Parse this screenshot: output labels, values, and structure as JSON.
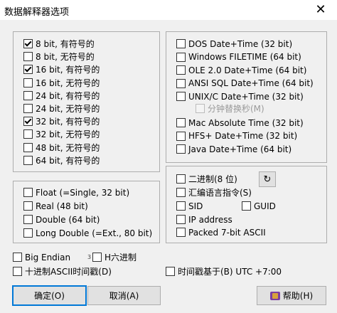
{
  "window": {
    "title": "数据解释器选项",
    "close_glyph": "✕"
  },
  "integer_panel": {
    "items": [
      {
        "label": "8 bit, 有符号的",
        "checked": true
      },
      {
        "label": "8 bit, 无符号的",
        "checked": false
      },
      {
        "label": "16 bit, 有符号的",
        "checked": true
      },
      {
        "label": "16 bit, 无符号的",
        "checked": false
      },
      {
        "label": "24 bit, 有符号的",
        "checked": false
      },
      {
        "label": "24 bit, 无符号的",
        "checked": false
      },
      {
        "label": "32 bit, 有符号的",
        "checked": true
      },
      {
        "label": "32 bit, 无符号的",
        "checked": false
      },
      {
        "label": "48 bit, 无符号的",
        "checked": false
      },
      {
        "label": "64 bit, 有符号的",
        "checked": false
      }
    ]
  },
  "float_panel": {
    "items": [
      {
        "label": "Float (=Single, 32 bit)",
        "checked": false
      },
      {
        "label": "Real (48 bit)",
        "checked": false
      },
      {
        "label": "Double (64 bit)",
        "checked": false
      },
      {
        "label": "Long Double (=Ext., 80 bit)",
        "checked": false
      }
    ]
  },
  "date_panel": {
    "items": [
      {
        "label": "DOS Date+Time (32 bit)",
        "checked": false
      },
      {
        "label": "Windows FILETIME (64 bit)",
        "checked": false
      },
      {
        "label": "OLE 2.0 Date+Time (64 bit)",
        "checked": false
      },
      {
        "label": "ANSI SQL Date+Time (64 bit)",
        "checked": false
      },
      {
        "label": "UNIX/C Date+Time (32 bit)",
        "checked": false
      }
    ],
    "minute_swap": {
      "label": "分钟替换秒(M)",
      "checked": false
    },
    "items2": [
      {
        "label": "Mac Absolute Time (32 bit)",
        "checked": false
      },
      {
        "label": "HFS+ Date+Time (32 bit)",
        "checked": false
      },
      {
        "label": "Java Date+Time (64 bit)",
        "checked": false
      }
    ]
  },
  "misc_panel": {
    "binary": {
      "label": "二进制(8 位)",
      "checked": false
    },
    "refresh_glyph": "↻",
    "asm": {
      "label": "汇编语言指令(S)",
      "checked": false
    },
    "sid": {
      "label": "SID",
      "checked": false
    },
    "guid": {
      "label": "GUID",
      "checked": false
    },
    "ip": {
      "label": "IP address",
      "checked": false
    },
    "packed": {
      "label": "Packed 7-bit ASCII",
      "checked": false
    }
  },
  "bottom": {
    "big_endian": {
      "label": "Big Endian",
      "checked": false
    },
    "hex_digit": "3",
    "hex": {
      "label": "H六进制",
      "checked": false
    },
    "decimal_ts": {
      "label": "十进制ASCII时间戳(D)",
      "checked": false
    },
    "ts_base": {
      "label": "时间戳基于(B) UTC +7:00",
      "checked": false
    }
  },
  "buttons": {
    "ok": "确定(O)",
    "cancel": "取消(A)",
    "help": "帮助(H)"
  }
}
